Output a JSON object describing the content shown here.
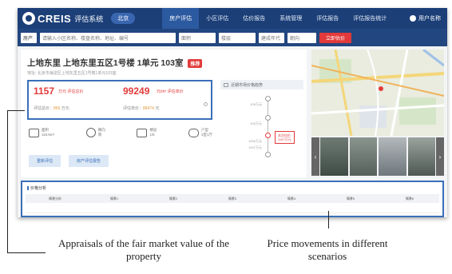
{
  "nav": {
    "brand": "CREIS",
    "brand_sub": "评估系统",
    "city": "北京",
    "items": [
      "房产评估",
      "小区评估",
      "估价报告",
      "系统管理",
      "评估报告",
      "评估报告统计"
    ],
    "user": "用户名称"
  },
  "filter": {
    "type": "房产",
    "keyword_placeholder": "请输入小区名称、楼盘名称、地址、编号",
    "area": "面积",
    "floor": "楼层",
    "age": "建成年代",
    "orientation": "朝向",
    "search_button": "立即估价"
  },
  "property": {
    "title": "上地东里 上地东里五区1号楼 1单元 103室",
    "tag": "推荐",
    "subtitle": "地址: 北京市海淀区上地东里五区1号楼1单元103室",
    "total_price": "1157",
    "total_unit": "万元 评估总价",
    "unit_price": "99249",
    "unit_unit": "元/m² 评估单价",
    "total_range_label": "评估总价：",
    "total_range_value": "869",
    "total_range_unit": "万元",
    "unit_range_label": "评估单价：",
    "unit_range_value": "88474",
    "unit_range_unit": "元",
    "attributes": [
      {
        "icon": "area-icon",
        "label": "面积",
        "value": "116.6m²"
      },
      {
        "icon": "compass-icon",
        "label": "朝向",
        "value": "南"
      },
      {
        "icon": "floor-icon",
        "label": "楼层",
        "value": "1/6"
      },
      {
        "icon": "layout-icon",
        "label": "户型",
        "value": "3室1厅"
      }
    ],
    "buttons": [
      "重新评估",
      "房产评估报告"
    ]
  },
  "scenario": {
    "title": "近期市场价格趋势",
    "labels": [
      "109万元",
      "100万元",
      "1000万元",
      "1157万元"
    ],
    "current_label": "本次估价",
    "current_value": "1157万元"
  },
  "analysis": {
    "title": "价格分析",
    "columns": [
      "情景分析",
      "情景1",
      "情景2",
      "情景3",
      "情景4",
      "情景5",
      "情景6"
    ]
  },
  "captions": {
    "left": "Appraisals of the fair market value of the property",
    "right": "Price movements in different scenarios"
  }
}
